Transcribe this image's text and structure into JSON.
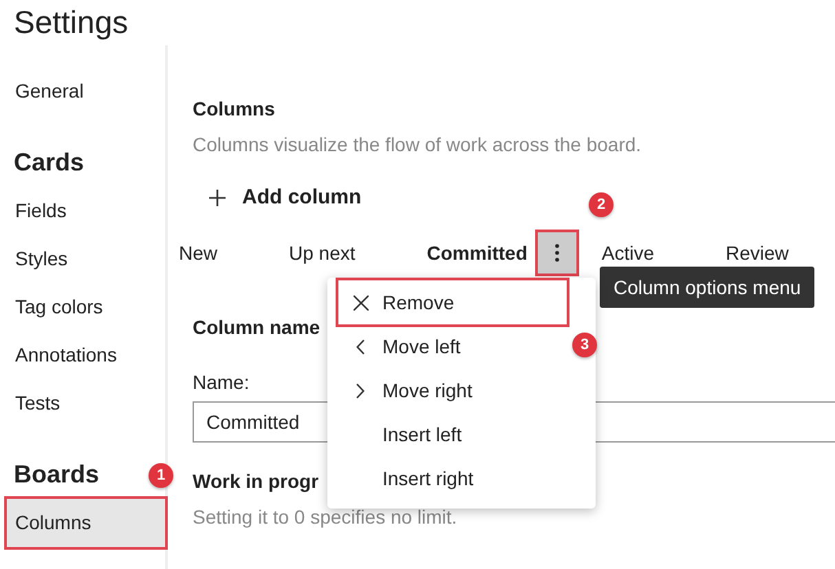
{
  "title": "Settings",
  "sidebar": {
    "items": [
      {
        "kind": "item",
        "label": "General",
        "selected": false,
        "highlighted": false
      },
      {
        "kind": "heading",
        "label": "Cards"
      },
      {
        "kind": "item",
        "label": "Fields",
        "selected": false,
        "highlighted": false
      },
      {
        "kind": "item",
        "label": "Styles",
        "selected": false,
        "highlighted": false
      },
      {
        "kind": "item",
        "label": "Tag colors",
        "selected": false,
        "highlighted": false
      },
      {
        "kind": "item",
        "label": "Annotations",
        "selected": false,
        "highlighted": false
      },
      {
        "kind": "item",
        "label": "Tests",
        "selected": false,
        "highlighted": false
      },
      {
        "kind": "heading",
        "label": "Boards"
      },
      {
        "kind": "item",
        "label": "Columns",
        "selected": true,
        "highlighted": true
      }
    ]
  },
  "columns_section": {
    "heading": "Columns",
    "description": "Columns visualize the flow of work across the board.",
    "add_button": "Add column",
    "tabs": [
      {
        "label": "New",
        "selected": false
      },
      {
        "label": "Up next",
        "selected": false
      },
      {
        "label": "Committed",
        "selected": true
      },
      {
        "label": "Active",
        "selected": false
      },
      {
        "label": "Review",
        "selected": false
      }
    ],
    "options_button": {
      "highlighted": true
    },
    "tooltip": "Column options menu"
  },
  "menu": {
    "items": [
      {
        "kind": "remove",
        "label": "Remove",
        "highlighted": true
      },
      {
        "kind": "left",
        "label": "Move left",
        "highlighted": false
      },
      {
        "kind": "right",
        "label": "Move right",
        "highlighted": false
      },
      {
        "kind": "plain",
        "label": "Insert left",
        "highlighted": false
      },
      {
        "kind": "plain",
        "label": "Insert right",
        "highlighted": false
      }
    ]
  },
  "column_name": {
    "heading": "Column name",
    "label": "Name:",
    "value": "Committed"
  },
  "wip": {
    "heading": "Work in progr",
    "description": "Setting it to 0 specifies no limit."
  },
  "step_badges": [
    "1",
    "2",
    "3"
  ]
}
